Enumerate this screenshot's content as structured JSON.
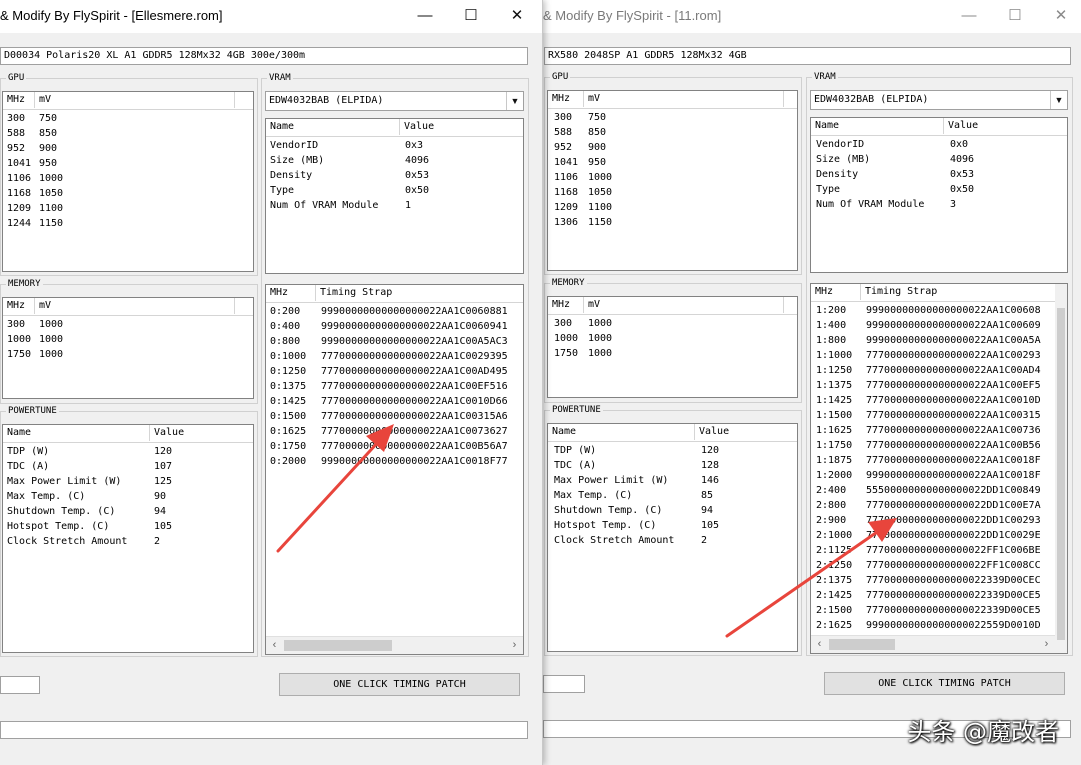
{
  "left": {
    "title": "& Modify By FlySpirit - [Ellesmere.rom]",
    "window_controls": {
      "minimize": "—",
      "maximize": "☐",
      "close": "✕"
    },
    "gpu_info": "D00034 Polaris20 XL A1 GDDR5 128Mx32 4GB 300e/300m",
    "gpu": {
      "label": "GPU",
      "headers": [
        "MHz",
        "mV"
      ],
      "rows": [
        [
          "300",
          "750"
        ],
        [
          "588",
          "850"
        ],
        [
          "952",
          "900"
        ],
        [
          "1041",
          "950"
        ],
        [
          "1106",
          "1000"
        ],
        [
          "1168",
          "1050"
        ],
        [
          "1209",
          "1100"
        ],
        [
          "1244",
          "1150"
        ]
      ]
    },
    "memory": {
      "label": "MEMORY",
      "headers": [
        "MHz",
        "mV"
      ],
      "rows": [
        [
          "300",
          "1000"
        ],
        [
          "1000",
          "1000"
        ],
        [
          "1750",
          "1000"
        ]
      ]
    },
    "powertune": {
      "label": "POWERTUNE",
      "headers": [
        "Name",
        "Value"
      ],
      "rows": [
        [
          "TDP (W)",
          "120"
        ],
        [
          "TDC (A)",
          "107"
        ],
        [
          "Max Power Limit (W)",
          "125"
        ],
        [
          "Max Temp. (C)",
          "90"
        ],
        [
          "Shutdown Temp. (C)",
          "94"
        ],
        [
          "Hotspot Temp. (C)",
          "105"
        ],
        [
          "Clock Stretch Amount",
          "2"
        ]
      ]
    },
    "vram": {
      "label": "VRAM",
      "selected": "EDW4032BAB (ELPIDA)",
      "headers": [
        "Name",
        "Value"
      ],
      "rows": [
        [
          "VendorID",
          "0x3"
        ],
        [
          "Size (MB)",
          "4096"
        ],
        [
          "Density",
          "0x53"
        ],
        [
          "Type",
          "0x50"
        ],
        [
          "Num Of VRAM Module",
          "1"
        ]
      ]
    },
    "timing": {
      "headers": [
        "MHz",
        "Timing Strap"
      ],
      "rows": [
        [
          "0:200",
          "99900000000000000022AA1C0060881"
        ],
        [
          "0:400",
          "99900000000000000022AA1C0060941"
        ],
        [
          "0:800",
          "99900000000000000022AA1C00A5AC3"
        ],
        [
          "0:1000",
          "77700000000000000022AA1C0029395"
        ],
        [
          "0:1250",
          "77700000000000000022AA1C00AD495"
        ],
        [
          "0:1375",
          "77700000000000000022AA1C00EF516"
        ],
        [
          "0:1425",
          "77700000000000000022AA1C0010D66"
        ],
        [
          "0:1500",
          "77700000000000000022AA1C00315A6"
        ],
        [
          "0:1625",
          "77700000000000000022AA1C0073627"
        ],
        [
          "0:1750",
          "77700000000000000022AA1C00B56A7"
        ],
        [
          "0:2000",
          "99900000000000000022AA1C0018F77"
        ]
      ]
    },
    "button": "ONE CLICK TIMING PATCH"
  },
  "right": {
    "title": "& Modify By FlySpirit - [11.rom]",
    "window_controls": {
      "minimize": "—",
      "maximize": "☐",
      "close": "✕"
    },
    "gpu_info": "RX580 2048SP A1 GDDR5 128Mx32 4GB",
    "gpu": {
      "label": "GPU",
      "headers": [
        "MHz",
        "mV"
      ],
      "rows": [
        [
          "300",
          "750"
        ],
        [
          "588",
          "850"
        ],
        [
          "952",
          "900"
        ],
        [
          "1041",
          "950"
        ],
        [
          "1106",
          "1000"
        ],
        [
          "1168",
          "1050"
        ],
        [
          "1209",
          "1100"
        ],
        [
          "1306",
          "1150"
        ]
      ]
    },
    "memory": {
      "label": "MEMORY",
      "headers": [
        "MHz",
        "mV"
      ],
      "rows": [
        [
          "300",
          "1000"
        ],
        [
          "1000",
          "1000"
        ],
        [
          "1750",
          "1000"
        ]
      ]
    },
    "powertune": {
      "label": "POWERTUNE",
      "headers": [
        "Name",
        "Value"
      ],
      "rows": [
        [
          "TDP (W)",
          "120"
        ],
        [
          "TDC (A)",
          "128"
        ],
        [
          "Max Power Limit (W)",
          "146"
        ],
        [
          "Max Temp. (C)",
          "85"
        ],
        [
          "Shutdown Temp. (C)",
          "94"
        ],
        [
          "Hotspot Temp. (C)",
          "105"
        ],
        [
          "Clock Stretch Amount",
          "2"
        ]
      ]
    },
    "vram": {
      "label": "VRAM",
      "selected": "EDW4032BAB (ELPIDA)",
      "headers": [
        "Name",
        "Value"
      ],
      "rows": [
        [
          "VendorID",
          "0x0"
        ],
        [
          "Size (MB)",
          "4096"
        ],
        [
          "Density",
          "0x53"
        ],
        [
          "Type",
          "0x50"
        ],
        [
          "Num Of VRAM Module",
          "3"
        ]
      ]
    },
    "timing": {
      "headers": [
        "MHz",
        "Timing Strap"
      ],
      "rows": [
        [
          "1:200",
          "99900000000000000022AA1C00608"
        ],
        [
          "1:400",
          "99900000000000000022AA1C00609"
        ],
        [
          "1:800",
          "99900000000000000022AA1C00A5A"
        ],
        [
          "1:1000",
          "77700000000000000022AA1C00293"
        ],
        [
          "1:1250",
          "77700000000000000022AA1C00AD4"
        ],
        [
          "1:1375",
          "77700000000000000022AA1C00EF5"
        ],
        [
          "1:1425",
          "77700000000000000022AA1C0010D"
        ],
        [
          "1:1500",
          "77700000000000000022AA1C00315"
        ],
        [
          "1:1625",
          "77700000000000000022AA1C00736"
        ],
        [
          "1:1750",
          "77700000000000000022AA1C00B56"
        ],
        [
          "1:1875",
          "77700000000000000022AA1C0018F"
        ],
        [
          "1:2000",
          "99900000000000000022AA1C0018F"
        ],
        [
          "2:400",
          "55500000000000000022DD1C00849"
        ],
        [
          "2:800",
          "77700000000000000022DD1C00E7A"
        ],
        [
          "2:900",
          "77700000000000000022DD1C00293"
        ],
        [
          "2:1000",
          "77700000000000000022DD1C0029E"
        ],
        [
          "2:1125",
          "77700000000000000022FF1C006BE"
        ],
        [
          "2:1250",
          "77700000000000000022FF1C008CC"
        ],
        [
          "2:1375",
          "77700000000000000022339D00CEC"
        ],
        [
          "2:1425",
          "77700000000000000022339D00CE5"
        ],
        [
          "2:1500",
          "77700000000000000022339D00CE5"
        ],
        [
          "2:1625",
          "99900000000000000022559D0010D"
        ]
      ]
    },
    "button": "ONE CLICK TIMING PATCH"
  },
  "watermark": "头条 @魔改者",
  "arrow_color": "#e8453c"
}
